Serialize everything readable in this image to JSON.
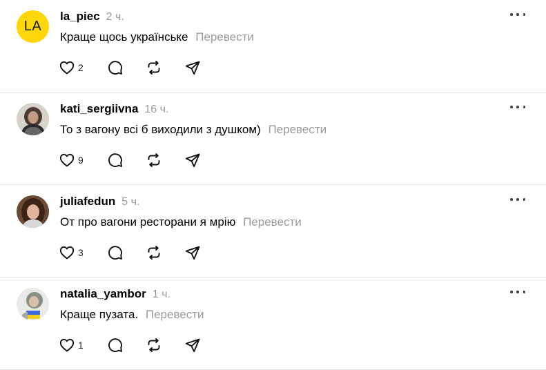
{
  "actions": {
    "translate_label": "Перевести"
  },
  "posts": [
    {
      "username": "la_piec",
      "time": "2 ч.",
      "avatar_initials": "LA",
      "text": "Краще щось українське",
      "likes": "2"
    },
    {
      "username": "kati_sergiivna",
      "time": "16 ч.",
      "avatar_initials": "",
      "text": "То з вагону всі б виходили з душком)",
      "likes": "9"
    },
    {
      "username": "juliafedun",
      "time": "5 ч.",
      "avatar_initials": "",
      "text": "От про вагони ресторани я мрію",
      "likes": "3"
    },
    {
      "username": "natalia_yambor",
      "time": "1 ч.",
      "avatar_initials": "",
      "text": "Краще пузата.",
      "likes": "1"
    }
  ],
  "icons": {
    "like": "heart-icon",
    "reply": "comment-icon",
    "repost": "repost-icon",
    "share": "send-icon",
    "more": "more-dots-icon"
  },
  "colors": {
    "avatar_yellow": "#ffd60a",
    "muted_text": "#9a9a9a",
    "divider": "#e3e3e3"
  }
}
